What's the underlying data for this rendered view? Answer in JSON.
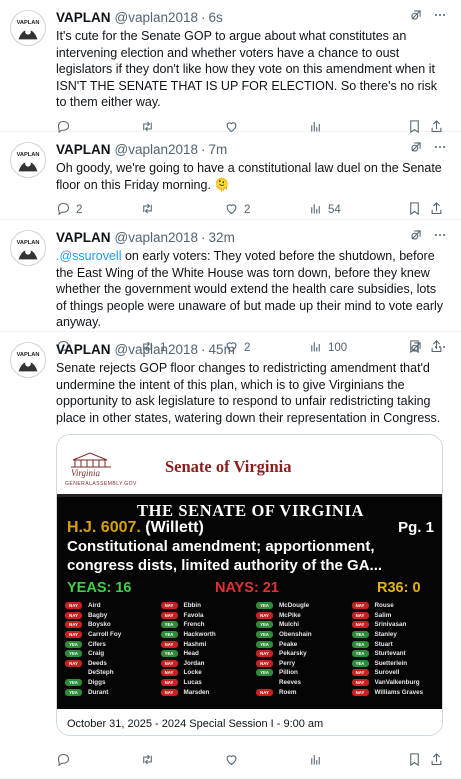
{
  "author": {
    "name": "VAPLAN",
    "handle": "@vaplan2018",
    "dot": "·",
    "avatar_text": "VAPLAN"
  },
  "colors": {
    "link": "#1d9bf0",
    "yea": "#2e8b3a",
    "nay": "#c62222",
    "senate_red": "#8c1d1d"
  },
  "tweets": [
    {
      "time": "6s",
      "text": "It's cute for the Senate GOP to argue about what constitutes an intervening election and whether voters have a chance to oust legislators if they don't like how they vote on this amendment when it ISN'T THE SENATE THAT IS UP FOR ELECTION. So there's no risk to them either way.",
      "replies": "",
      "retweets": "",
      "likes": "",
      "views": ""
    },
    {
      "time": "7m",
      "text": "Oh goody, we're going to have a constitutional law duel on the Senate floor on this Friday morning. 🫠",
      "replies": "2",
      "retweets": "",
      "likes": "2",
      "views": "54"
    },
    {
      "time": "32m",
      "mention": ".@ssurovell",
      "text": " on early voters: They voted before the shutdown, before the East Wing of the White House was torn down, before they knew whether the government would extend the health care subsidies, lots of things people were unaware of but made up their mind to vote early anyway.",
      "replies": "",
      "retweets": "1",
      "likes": "2",
      "views": "100"
    },
    {
      "time": "45m",
      "text": "Senate rejects GOP floor changes to redistricting amendment that'd undermine the intent of this plan, which is to give Virginians the opportunity to ask legislature to respond to unfair redistricting taking place in other states, watering down their representation in Congress.",
      "replies": "",
      "retweets": "",
      "likes": "",
      "views": ""
    }
  ],
  "media": {
    "logo_word": "Virginia",
    "logo_caption": "GENERALASSEMBLY.GOV",
    "senate_label": "Senate of Virginia",
    "board_title": "THE SENATE OF VIRGINIA",
    "bill": "H.J. 6007.",
    "patron": "(Willett)",
    "page": "Pg. 1",
    "description": "Constitutional amendment; apportionment, congress dists, limited authority of the GA...",
    "yeas": "YEAS: 16",
    "nays": "NAYS: 21",
    "r36": "R36: 0",
    "vote_yea": "YEA",
    "vote_nay": "NAY",
    "columns": [
      [
        {
          "v": "nay",
          "n": "Aird"
        },
        {
          "v": "nay",
          "n": "Bagby"
        },
        {
          "v": "nay",
          "n": "Boysko"
        },
        {
          "v": "nay",
          "n": "Carroll Foy"
        },
        {
          "v": "yea",
          "n": "Cifers"
        },
        {
          "v": "yea",
          "n": "Craig"
        },
        {
          "v": "nay",
          "n": "Deeds"
        },
        {
          "v": "none",
          "n": "DeSteph"
        },
        {
          "v": "yea",
          "n": "Diggs"
        },
        {
          "v": "yea",
          "n": "Durant"
        }
      ],
      [
        {
          "v": "nay",
          "n": "Ebbin"
        },
        {
          "v": "nay",
          "n": "Favola"
        },
        {
          "v": "yea",
          "n": "French"
        },
        {
          "v": "yea",
          "n": "Hackworth"
        },
        {
          "v": "nay",
          "n": "Hashmi"
        },
        {
          "v": "yea",
          "n": "Head"
        },
        {
          "v": "nay",
          "n": "Jordan"
        },
        {
          "v": "nay",
          "n": "Locke"
        },
        {
          "v": "nay",
          "n": "Lucas"
        },
        {
          "v": "nay",
          "n": "Marsden"
        }
      ],
      [
        {
          "v": "yea",
          "n": "McDougle"
        },
        {
          "v": "nay",
          "n": "McPike"
        },
        {
          "v": "yea",
          "n": "Mulchi"
        },
        {
          "v": "yea",
          "n": "Obenshain"
        },
        {
          "v": "yea",
          "n": "Peake"
        },
        {
          "v": "nay",
          "n": "Pekarsky"
        },
        {
          "v": "nay",
          "n": "Perry"
        },
        {
          "v": "yea",
          "n": "Pillion"
        },
        {
          "v": "none",
          "n": "Reeves"
        },
        {
          "v": "nay",
          "n": "Roem"
        }
      ],
      [
        {
          "v": "nay",
          "n": "Rouse"
        },
        {
          "v": "nay",
          "n": "Salim"
        },
        {
          "v": "nay",
          "n": "Srinivasan"
        },
        {
          "v": "yea",
          "n": "Stanley"
        },
        {
          "v": "yea",
          "n": "Stuart"
        },
        {
          "v": "yea",
          "n": "Sturtevant"
        },
        {
          "v": "yea",
          "n": "Suetterlein"
        },
        {
          "v": "nay",
          "n": "Surovell"
        },
        {
          "v": "nay",
          "n": "VanValkenburg"
        },
        {
          "v": "nay",
          "n": "Williams Graves"
        }
      ]
    ],
    "caption": "October 31, 2025 - 2024 Special Session I - 9:00 am"
  }
}
